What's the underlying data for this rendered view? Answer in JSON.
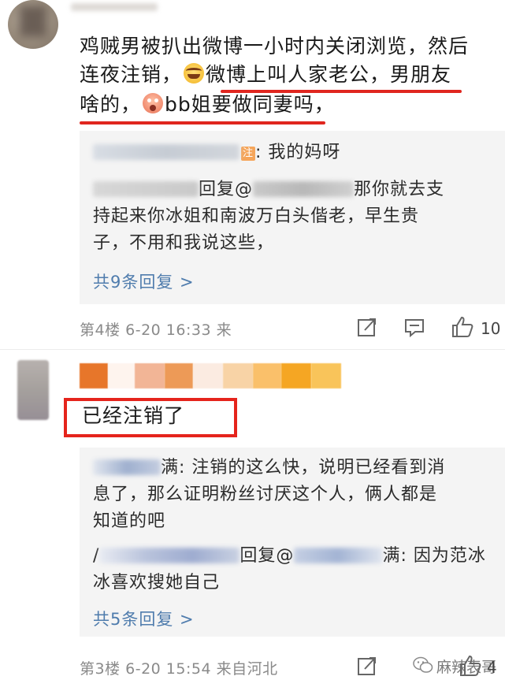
{
  "comment1": {
    "body_part1": "鸡贼男被扒出微博一小时内关闭浏览，然后",
    "body_part2": "连夜注销，",
    "body_part3": "微博上叫人家老公，男朋友",
    "body_part4": "啥的，",
    "body_part5": "bb姐要做同妻吗，",
    "emoji1": "laughing-face-emoji",
    "emoji2": "shocked-face-emoji",
    "replies": [
      {
        "suffix": ": 我的妈呀",
        "badge": "注"
      },
      {
        "mid": "回复@",
        "suffix": "那你就去支",
        "line2": "持起来你冰姐和南波万白头偕老，早生贵",
        "line3": "子，不用和我说这些，"
      }
    ],
    "more_replies": "共9条回复 >",
    "floor_meta": "第4楼 6-20 16:33 来",
    "like_count": "10"
  },
  "comment2": {
    "body": "已经注销了",
    "replies": [
      {
        "suffix": "满: 注销的这么快，说明已经看到消",
        "line2": "息了，那么证明粉丝讨厌这个人，俩人都是",
        "line3": "知道的吧"
      },
      {
        "prefix": "/",
        "mid": "回复@",
        "suffix": "满: 因为范冰",
        "line2": "冰喜欢搜她自己"
      }
    ],
    "more_replies": "共5条回复 >",
    "floor_meta": "第3楼 6-20 15:54 来自河北",
    "like_count": "4"
  },
  "watermark": "麻辣表哥",
  "colors": {
    "highlight_red": "#e0261f",
    "link_blue": "#4f7cad",
    "reply_bg": "#f4f4f4"
  }
}
